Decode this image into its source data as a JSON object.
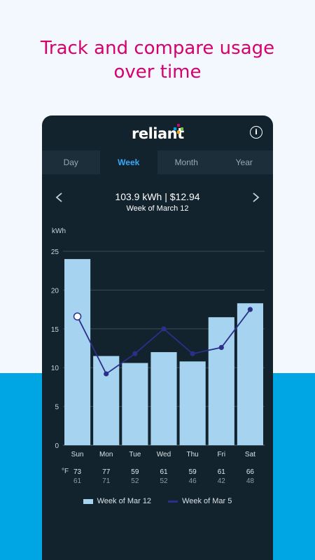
{
  "headline": {
    "line1": "Track and compare usage",
    "line2": "over time"
  },
  "app": {
    "logo_text": "reliant",
    "info_icon": "info-icon"
  },
  "tabs": [
    {
      "label": "Day",
      "active": false
    },
    {
      "label": "Week",
      "active": true
    },
    {
      "label": "Month",
      "active": false
    },
    {
      "label": "Year",
      "active": false
    }
  ],
  "period": {
    "summary": "103.9 kWh | $12.94",
    "label": "Week of March 12"
  },
  "chart_data": {
    "type": "bar",
    "ylabel": "kWh",
    "ylim": [
      0,
      25
    ],
    "yticks": [
      0,
      5,
      10,
      15,
      20,
      25
    ],
    "categories": [
      "Sun",
      "Mon",
      "Tue",
      "Wed",
      "Thu",
      "Fri",
      "Sat"
    ],
    "series": [
      {
        "name": "Week of Mar 12",
        "type": "bar",
        "color": "#a6d3f0",
        "values": [
          24.0,
          11.5,
          10.6,
          12.0,
          10.8,
          16.5,
          18.3
        ]
      },
      {
        "name": "Week of Mar 5",
        "type": "line",
        "color": "#2c2f8a",
        "values": [
          16.6,
          9.2,
          11.8,
          15.0,
          11.8,
          12.6,
          17.5
        ]
      }
    ],
    "grid": true
  },
  "temps": {
    "unit": "°F",
    "highs": [
      "73",
      "77",
      "59",
      "61",
      "59",
      "61",
      "66"
    ],
    "lows": [
      "61",
      "71",
      "52",
      "52",
      "46",
      "42",
      "48"
    ]
  },
  "colors": {
    "headline": "#d6006f",
    "background_bottom": "#00a6e3",
    "panel": "#12232e",
    "active_tab": "#39a9f5"
  }
}
